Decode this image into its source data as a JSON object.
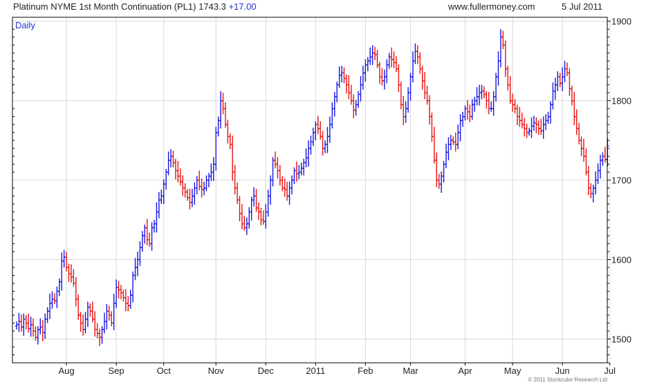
{
  "header": {
    "title": "Platinum NYME 1st Month Continuation (PL1) 1743.3",
    "change": "+17.00",
    "site": "www.fullermoney.com",
    "date": "5 Jul 2011"
  },
  "copyright": "© 2011 Stockcube Research Ltd",
  "colors": {
    "up": "#1515e0",
    "down": "#e81010",
    "grid": "#d8d8d8",
    "axis": "#000000",
    "period_label": "#2233cc"
  },
  "chart_data": {
    "type": "ohlc",
    "period_label": "Daily",
    "ylim": [
      1470,
      1905
    ],
    "y_ticks": [
      1500,
      1600,
      1700,
      1800,
      1900
    ],
    "x_index_range": [
      0,
      246
    ],
    "x_ticks": [
      {
        "label": "Aug",
        "index": 21
      },
      {
        "label": "Sep",
        "index": 42
      },
      {
        "label": "Oct",
        "index": 62
      },
      {
        "label": "Nov",
        "index": 84
      },
      {
        "label": "Dec",
        "index": 105
      },
      {
        "label": "2011",
        "index": 126
      },
      {
        "label": "Feb",
        "index": 147
      },
      {
        "label": "Mar",
        "index": 166
      },
      {
        "label": "Apr",
        "index": 189
      },
      {
        "label": "May",
        "index": 209
      },
      {
        "label": "Jun",
        "index": 230
      },
      {
        "label": "Jul",
        "index": 250
      }
    ],
    "series": [
      {
        "name": "PL1",
        "close": [
          1518,
          1522,
          1515,
          1525,
          1520,
          1513,
          1518,
          1510,
          1502,
          1512,
          1515,
          1508,
          1525,
          1535,
          1545,
          1550,
          1548,
          1560,
          1572,
          1598,
          1603,
          1590,
          1582,
          1578,
          1570,
          1550,
          1530,
          1520,
          1512,
          1525,
          1540,
          1535,
          1525,
          1512,
          1507,
          1502,
          1512,
          1522,
          1535,
          1530,
          1520,
          1545,
          1565,
          1562,
          1558,
          1552,
          1545,
          1542,
          1555,
          1580,
          1590,
          1600,
          1615,
          1630,
          1640,
          1625,
          1620,
          1640,
          1645,
          1660,
          1675,
          1680,
          1695,
          1710,
          1725,
          1730,
          1722,
          1712,
          1705,
          1698,
          1690,
          1685,
          1678,
          1672,
          1680,
          1690,
          1700,
          1692,
          1688,
          1690,
          1700,
          1705,
          1710,
          1720,
          1760,
          1775,
          1800,
          1790,
          1770,
          1755,
          1745,
          1710,
          1690,
          1675,
          1658,
          1645,
          1640,
          1645,
          1660,
          1675,
          1680,
          1665,
          1660,
          1650,
          1648,
          1660,
          1680,
          1700,
          1725,
          1720,
          1712,
          1700,
          1690,
          1688,
          1680,
          1690,
          1700,
          1712,
          1708,
          1710,
          1715,
          1722,
          1728,
          1740,
          1748,
          1760,
          1770,
          1765,
          1755,
          1740,
          1745,
          1755,
          1770,
          1790,
          1805,
          1820,
          1832,
          1835,
          1828,
          1820,
          1810,
          1800,
          1788,
          1795,
          1808,
          1820,
          1835,
          1845,
          1850,
          1855,
          1860,
          1858,
          1845,
          1830,
          1825,
          1830,
          1845,
          1855,
          1852,
          1848,
          1840,
          1820,
          1795,
          1780,
          1790,
          1810,
          1830,
          1850,
          1862,
          1855,
          1840,
          1825,
          1810,
          1800,
          1780,
          1755,
          1725,
          1700,
          1695,
          1705,
          1720,
          1735,
          1745,
          1750,
          1748,
          1745,
          1760,
          1775,
          1780,
          1790,
          1786,
          1780,
          1795,
          1800,
          1805,
          1810,
          1812,
          1808,
          1800,
          1790,
          1790,
          1805,
          1830,
          1850,
          1880,
          1870,
          1840,
          1820,
          1800,
          1795,
          1790,
          1780,
          1775,
          1770,
          1765,
          1760,
          1762,
          1768,
          1772,
          1770,
          1765,
          1762,
          1770,
          1775,
          1780,
          1795,
          1812,
          1820,
          1830,
          1822,
          1830,
          1840,
          1835,
          1815,
          1800,
          1780,
          1765,
          1750,
          1740,
          1730,
          1710,
          1690,
          1683,
          1690,
          1700,
          1712,
          1725,
          1730,
          1726,
          1743
        ]
      }
    ]
  }
}
